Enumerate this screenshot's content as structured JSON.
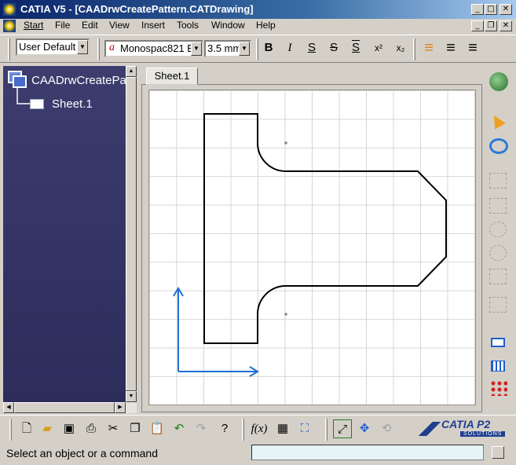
{
  "window": {
    "title": "CATIA V5 - [CAADrwCreatePattern.CATDrawing]",
    "btn_minimize": "_",
    "btn_maximize": "□",
    "btn_close": "✕",
    "btn_doc_restore": "❐"
  },
  "menubar": {
    "items": [
      {
        "label": "Start"
      },
      {
        "label": "File"
      },
      {
        "label": "Edit"
      },
      {
        "label": "View"
      },
      {
        "label": "Insert"
      },
      {
        "label": "Tools"
      },
      {
        "label": "Window"
      },
      {
        "label": "Help"
      }
    ]
  },
  "toolbar": {
    "style_value": "User Default",
    "font_prefix": "a",
    "font_value": "Monospac821 E",
    "size_value": "3.5 mm",
    "dropdown_arrow": "▼",
    "text_buttons": [
      {
        "glyph": "B",
        "icon": "bold-icon"
      },
      {
        "glyph": "I",
        "icon": "italic-icon"
      },
      {
        "glyph": "S",
        "icon": "underline-icon"
      },
      {
        "glyph": "S",
        "icon": "strikethrough-icon"
      },
      {
        "glyph": "S",
        "icon": "overline-icon"
      },
      {
        "glyph": "x²",
        "icon": "superscript-icon"
      },
      {
        "glyph": "x₂",
        "icon": "subscript-icon"
      }
    ],
    "align_buttons": [
      {
        "glyph": "≡",
        "icon": "align-left-icon",
        "color": "#e08020"
      },
      {
        "glyph": "≡",
        "icon": "align-center-icon",
        "color": "#000000"
      },
      {
        "glyph": "≡",
        "icon": "align-right-icon",
        "color": "#000000"
      }
    ]
  },
  "tree": {
    "root": "CAADrwCreatePattern",
    "child": "Sheet.1"
  },
  "sheet_tab": {
    "label": "Sheet.1"
  },
  "status": {
    "message": "Select an object or a command"
  },
  "branding": {
    "logo_text": "CATIA P2",
    "sub_text": "SOLUTIONS"
  },
  "colors": {
    "axis": "#1f6fd0",
    "tree_bg": "#33336a",
    "title_bar": "#0a246a"
  }
}
